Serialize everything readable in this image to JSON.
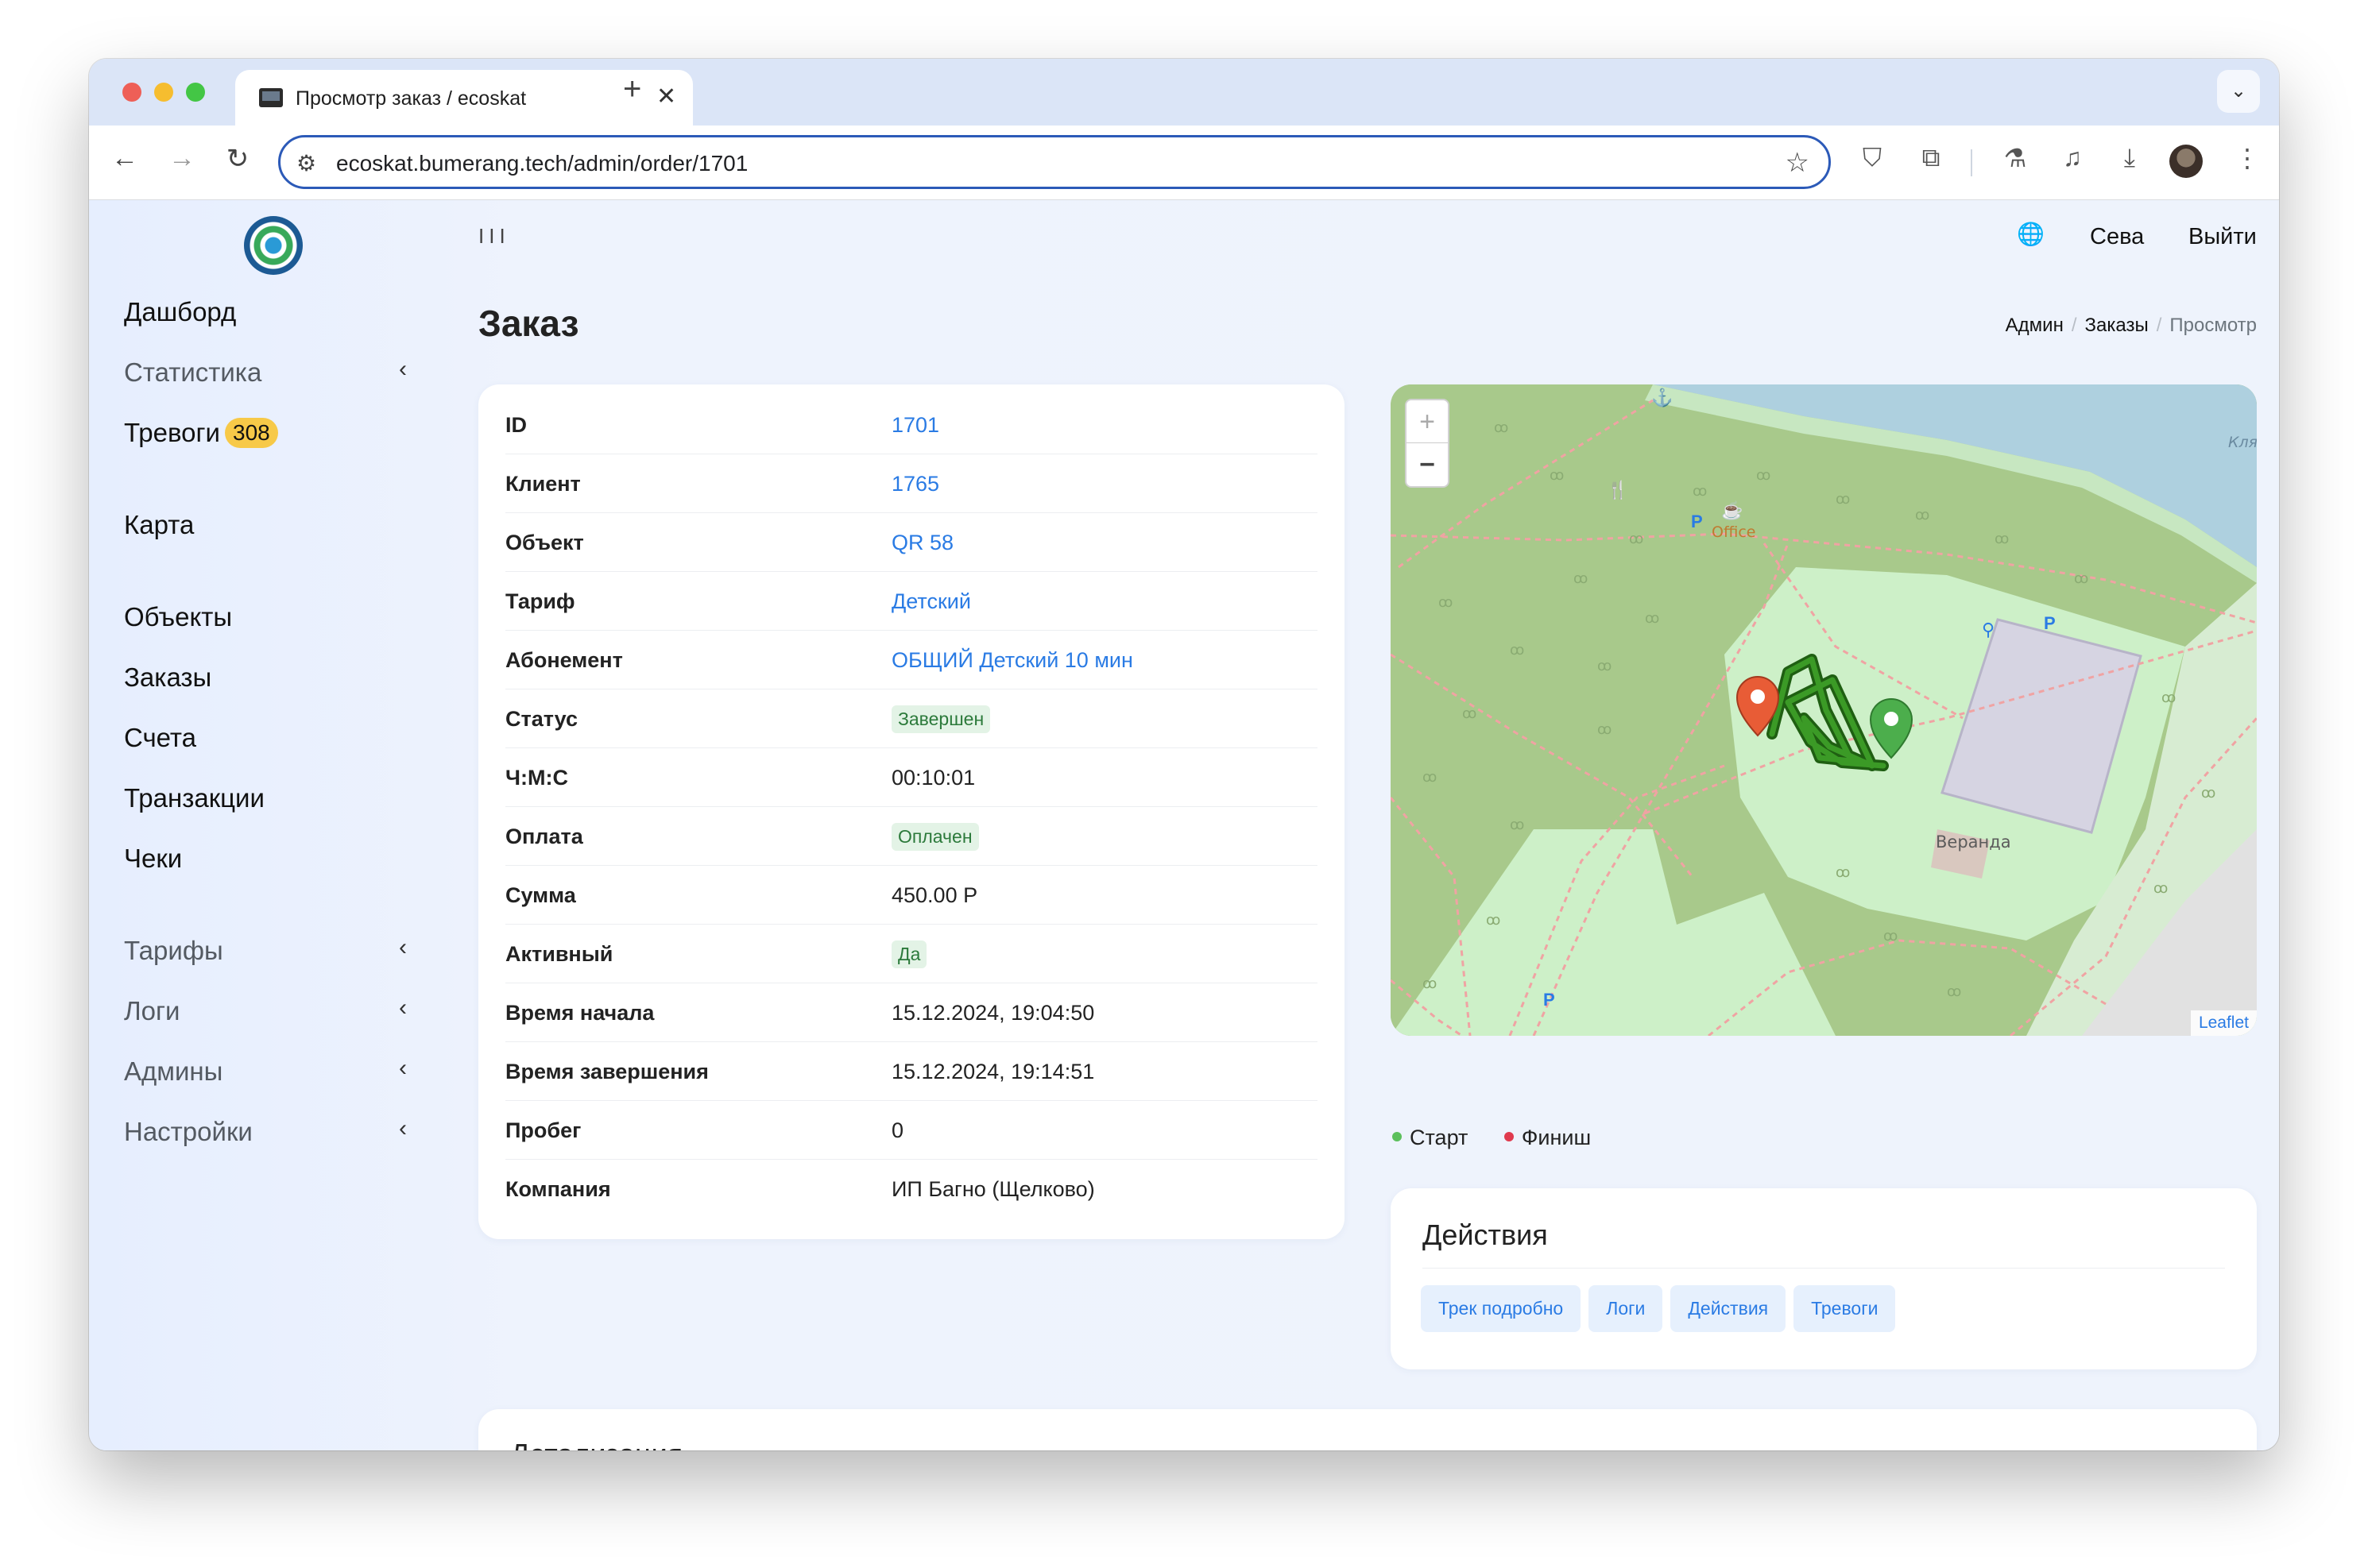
{
  "browser": {
    "tab_title": "Просмотр заказ / ecoskat",
    "new_tab_symbol": "+",
    "tab_close_symbol": "✕",
    "url": "ecoskat.bumerang.tech/admin/order/1701"
  },
  "sidebar": {
    "items": [
      {
        "label": "Дашборд"
      },
      {
        "label": "Статистика"
      },
      {
        "label": "Тревоги",
        "badge": "308"
      },
      {
        "label": "Карта"
      },
      {
        "label": "Объекты"
      },
      {
        "label": "Заказы"
      },
      {
        "label": "Счета"
      },
      {
        "label": "Транзакции"
      },
      {
        "label": "Чеки"
      },
      {
        "label": "Тарифы"
      },
      {
        "label": "Логи"
      },
      {
        "label": "Админы"
      },
      {
        "label": "Настройки"
      }
    ]
  },
  "header": {
    "menu_toggle": "III",
    "user": "Сева",
    "logout": "Выйти"
  },
  "page": {
    "title": "Заказ",
    "breadcrumb": [
      "Админ",
      "Заказы",
      "Просмотр"
    ]
  },
  "order": {
    "rows": [
      {
        "key": "ID",
        "value": "1701"
      },
      {
        "key": "Клиент",
        "value": "1765"
      },
      {
        "key": "Объект",
        "value": "QR 58"
      },
      {
        "key": "Тариф",
        "value": "Детский"
      },
      {
        "key": "Абонемент",
        "value": "ОБЩИЙ Детский 10 мин"
      },
      {
        "key": "Статус",
        "value": "Завершен"
      },
      {
        "key": "Ч:М:С",
        "value": "00:10:01"
      },
      {
        "key": "Оплата",
        "value": "Оплачен"
      },
      {
        "key": "Сумма",
        "value": "450.00 Р"
      },
      {
        "key": "Активный",
        "value": "Да"
      },
      {
        "key": "Время начала",
        "value": "15.12.2024, 19:04:50"
      },
      {
        "key": "Время завершения",
        "value": "15.12.2024, 19:14:51"
      },
      {
        "key": "Пробег",
        "value": "0"
      },
      {
        "key": "Компания",
        "value": "ИП Багно (Щелково)"
      }
    ]
  },
  "map": {
    "zoom_in": "+",
    "zoom_out": "−",
    "attribution": "Leaflet",
    "labels": {
      "office": "Office",
      "veranda": "Веранда",
      "street": "Кля"
    }
  },
  "legend": {
    "start": "Старт",
    "finish": "Финиш",
    "start_color": "#5cc05c",
    "finish_color": "#e03a4e"
  },
  "actions": {
    "title": "Действия",
    "buttons": [
      "Трек подробно",
      "Логи",
      "Действия",
      "Тревоги"
    ]
  },
  "detail": {
    "title": "Детализация"
  },
  "colors": {
    "accent": "#2a7be4",
    "badge": "#f7c948",
    "status_pill_bg": "#e3f3e6",
    "status_pill_text": "#2c7a3b"
  }
}
